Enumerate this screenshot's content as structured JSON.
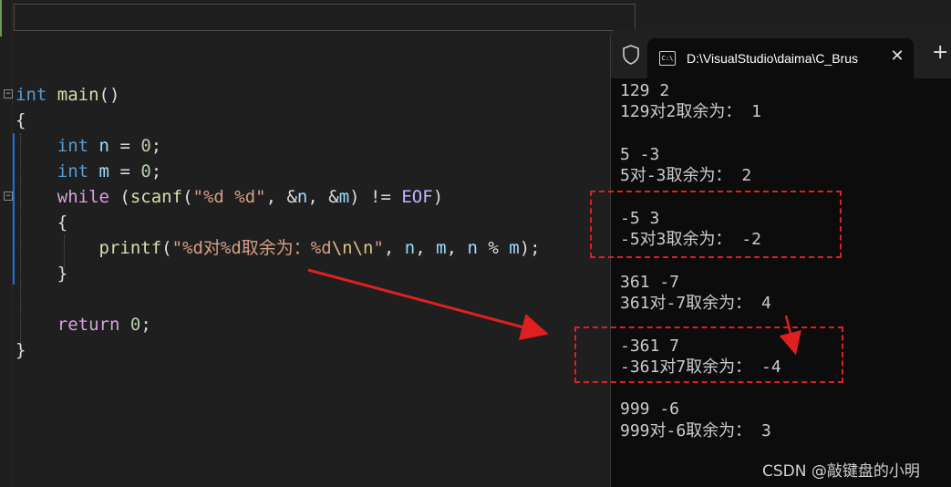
{
  "editor": {
    "code": {
      "l1": {
        "int": "int",
        "main": "main",
        "parens": "()"
      },
      "l2": {
        "brace": "{"
      },
      "l3": {
        "int": "int",
        "n": "n",
        "assign": " = ",
        "zero": "0",
        "semi": ";"
      },
      "l4": {
        "int": "int",
        "m": "m",
        "assign": " = ",
        "zero": "0",
        "semi": ";"
      },
      "l5": {
        "while": "while",
        "open": " (",
        "scanf": "scanf",
        "p1": "(",
        "fmt": "\"%d %d\"",
        "c1": ", &",
        "n": "n",
        "c2": ", &",
        "m": "m",
        "ne": ") != ",
        "eof": "EOF",
        "close": ")"
      },
      "l6": {
        "brace": "{"
      },
      "l7": {
        "printf": "printf",
        "p1": "(",
        "s1": "\"%d对%d取余为：%d",
        "esc": "\\n\\n",
        "s2": "\"",
        "c1": ", ",
        "n": "n",
        "c2": ", ",
        "m": "m",
        "c3": ", ",
        "n2": "n",
        "mod": " % ",
        "m2": "m",
        "end": ");"
      },
      "l8": {
        "brace": "}"
      },
      "l10": {
        "return": "return",
        "zero": "0",
        "semi": ";"
      },
      "l11": {
        "brace": "}"
      }
    }
  },
  "terminal": {
    "tab_title": "D:\\VisualStudio\\daima\\C_Brus",
    "tab_icon_text": "C:\\",
    "close_glyph": "✕",
    "new_tab_glyph": "+",
    "output": [
      "129 2",
      "129对2取余为： 1",
      "",
      "5 -3",
      "5对-3取余为： 2",
      "",
      "-5 3",
      "-5对3取余为： -2",
      "",
      "361 -7",
      "361对-7取余为： 4",
      "",
      "-361 7",
      "-361对7取余为： -4",
      "",
      "999 -6",
      "999对-6取余为： 3"
    ]
  },
  "watermark": "CSDN @敲键盘的小明",
  "colors": {
    "editor_bg": "#1f1f1f",
    "terminal_bg": "#0c0c0c",
    "annotation_red": "#e02020",
    "keyword_blue": "#569cd6",
    "control_purple": "#d8a0df",
    "string_orange": "#d69d85"
  },
  "icons": [
    "shield-icon",
    "cmd-icon",
    "close-icon",
    "plus-icon",
    "fold-icon"
  ]
}
